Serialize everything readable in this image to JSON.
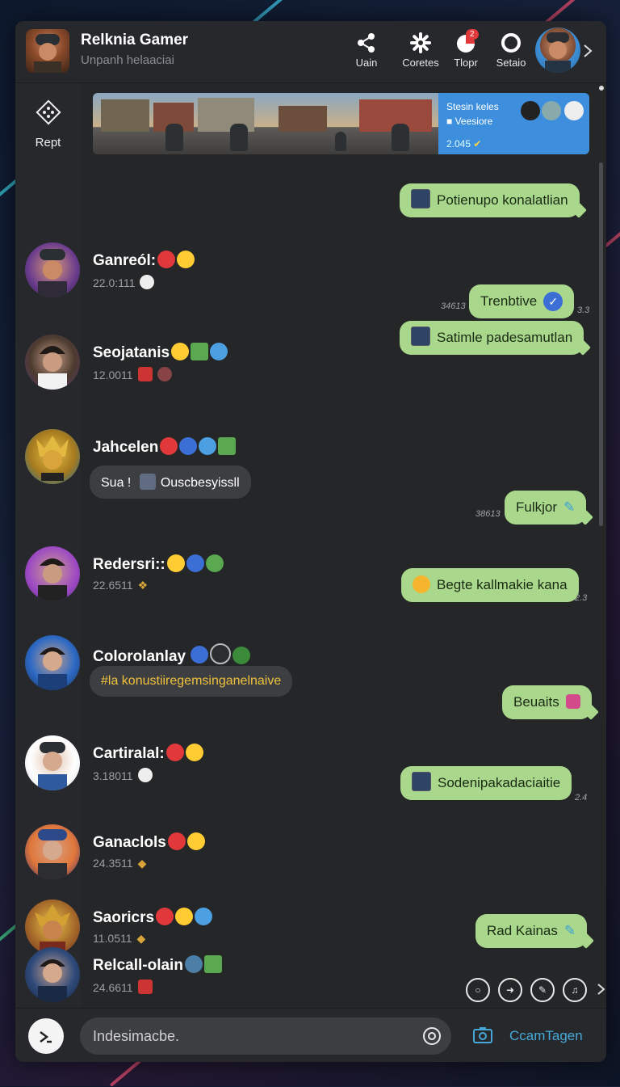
{
  "header": {
    "title": "Relknia Gamer",
    "subtitle": "Unpanh helaaciai",
    "actions": [
      {
        "label": "Uain",
        "icon": "share-icon"
      },
      {
        "label": "Coretes",
        "icon": "gear-icon"
      },
      {
        "label": "Tlopr",
        "icon": "notification-icon",
        "badge": "2"
      },
      {
        "label": "Setaio",
        "icon": "ring-icon"
      }
    ]
  },
  "sidebar": {
    "label": "Rept"
  },
  "banner": {
    "title": "Stesin keles",
    "subtitle": "Veesiore",
    "stat": "2.045"
  },
  "incoming": [
    {
      "name": "Ganreól:",
      "time": "22.0:111"
    },
    {
      "name": "Seojatanis",
      "time": "12.0011"
    },
    {
      "name": "Jahcelen",
      "bubble_prefix": "Sua !",
      "bubble_text": "Ouscbesyissll"
    },
    {
      "name": "Redersri::",
      "time": "22.6511"
    },
    {
      "name": "Colorolanlay",
      "bubble_text": "#la konustiiregemsinganelnaive"
    },
    {
      "name": "Cartiralal:",
      "time": "3.18011"
    },
    {
      "name": "Ganaclols",
      "time": "24.3511"
    },
    {
      "name": "Saoricrs",
      "time": "11.0511"
    },
    {
      "name": "Relcall-olain",
      "time": "24.6611"
    }
  ],
  "outgoing": [
    {
      "text": "Potienupo konalatlian"
    },
    {
      "text": "Trenbtive",
      "stamp": "3.3",
      "left_stamp": "34613"
    },
    {
      "text": "Satimle padesamutlan"
    },
    {
      "text": "Fulkjor",
      "left_stamp": "38613"
    },
    {
      "text": "Begte kallmakie kana",
      "stamp": "2.3"
    },
    {
      "text": "Beuaits"
    },
    {
      "text": "Sodenipakadaciaitie",
      "stamp": "2.4"
    },
    {
      "text": "Rad Kainas"
    }
  ],
  "composer": {
    "placeholder": "Indesimacbe.",
    "send_label": "CcamTagen"
  },
  "colors": {
    "background": "#242628",
    "outgoing_bubble": "#a9d88c",
    "incoming_bubble": "#3c3e42",
    "accent": "#46a8d8",
    "banner": "#3d8fde"
  }
}
